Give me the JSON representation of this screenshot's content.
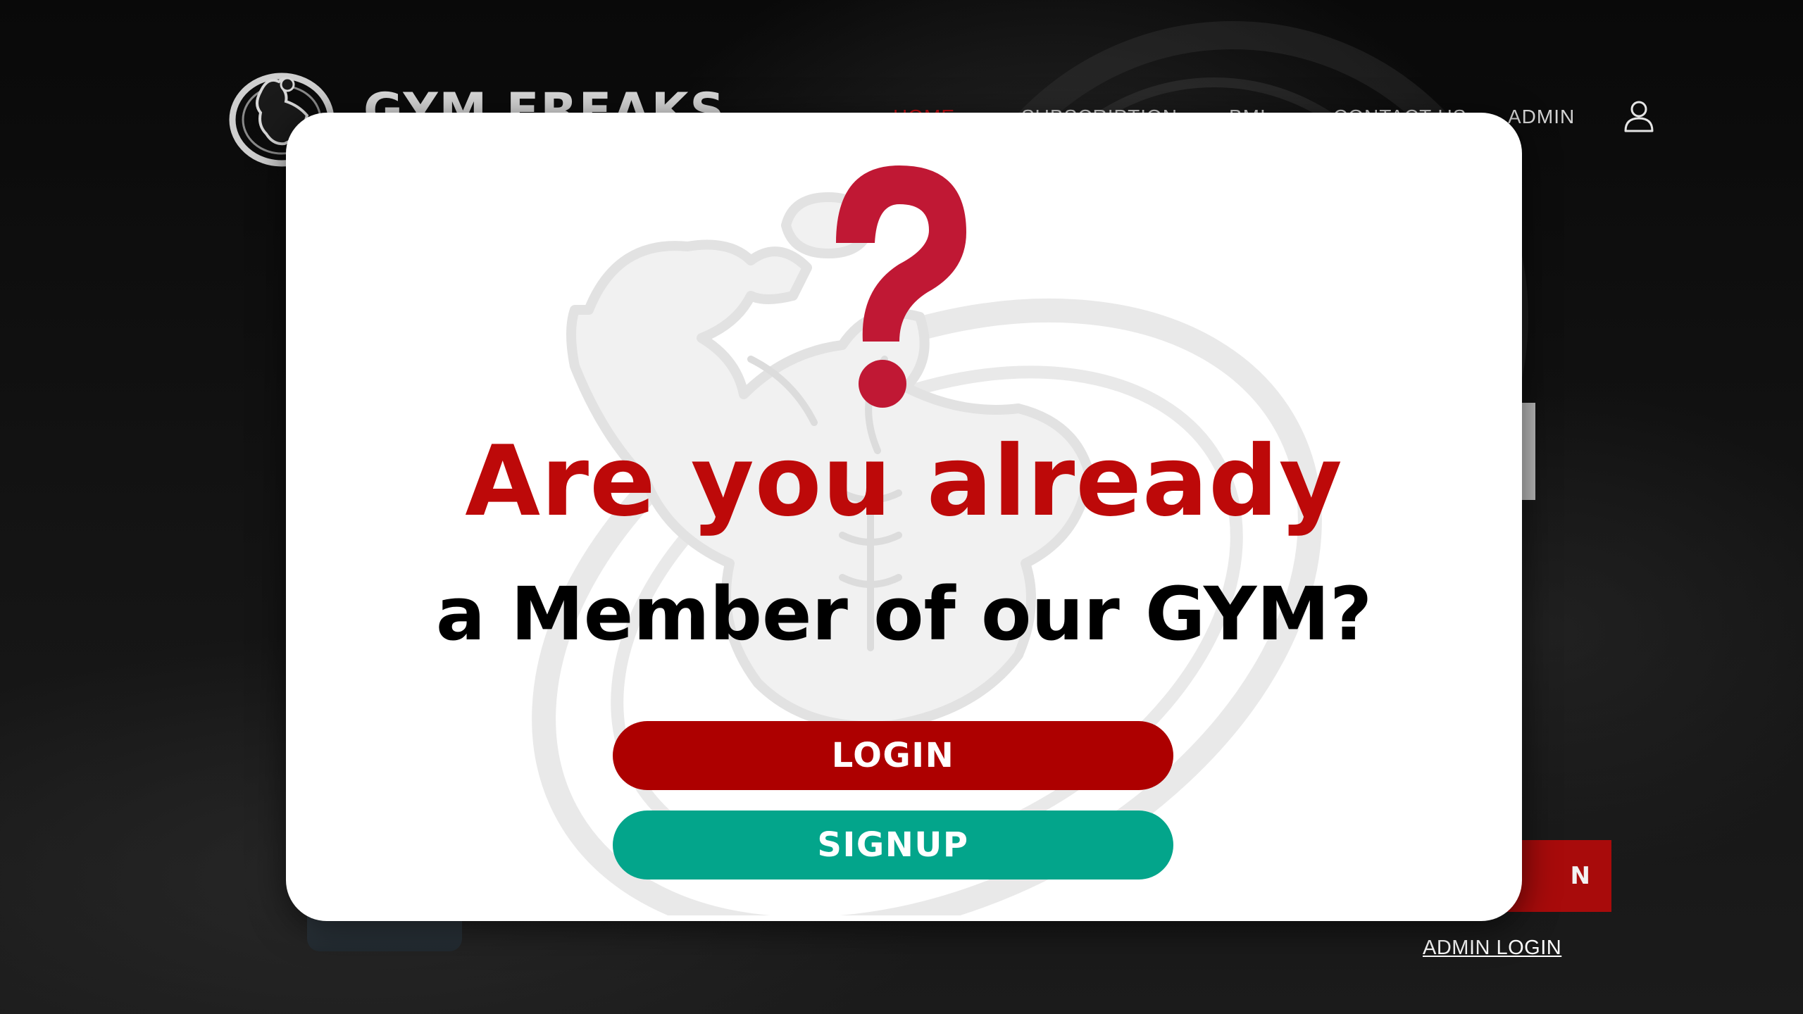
{
  "header": {
    "brand": "GYM FREAKS",
    "nav": [
      {
        "label": "HOME",
        "active": true
      },
      {
        "label": "SUBSCRIPTION",
        "active": false
      },
      {
        "label": "BMI",
        "active": false
      },
      {
        "label": "CONTACT US",
        "active": false
      },
      {
        "label": "ADMIN",
        "active": false
      }
    ],
    "user_icon": "user-icon"
  },
  "hero": {
    "join_button_label": "N",
    "admin_login_link": "ADMIN LOGIN"
  },
  "modal": {
    "icon": "question-mark-icon",
    "title": "Are you already",
    "subtitle": "a Member of our GYM?",
    "login_label": "LOGIN",
    "signup_label": "SIGNUP"
  },
  "colors": {
    "brand_red": "#bd0909",
    "login_button": "#ad0000",
    "signup_button": "#03a58b",
    "nav_active": "#c90d12",
    "modal_background": "#ffffff"
  }
}
